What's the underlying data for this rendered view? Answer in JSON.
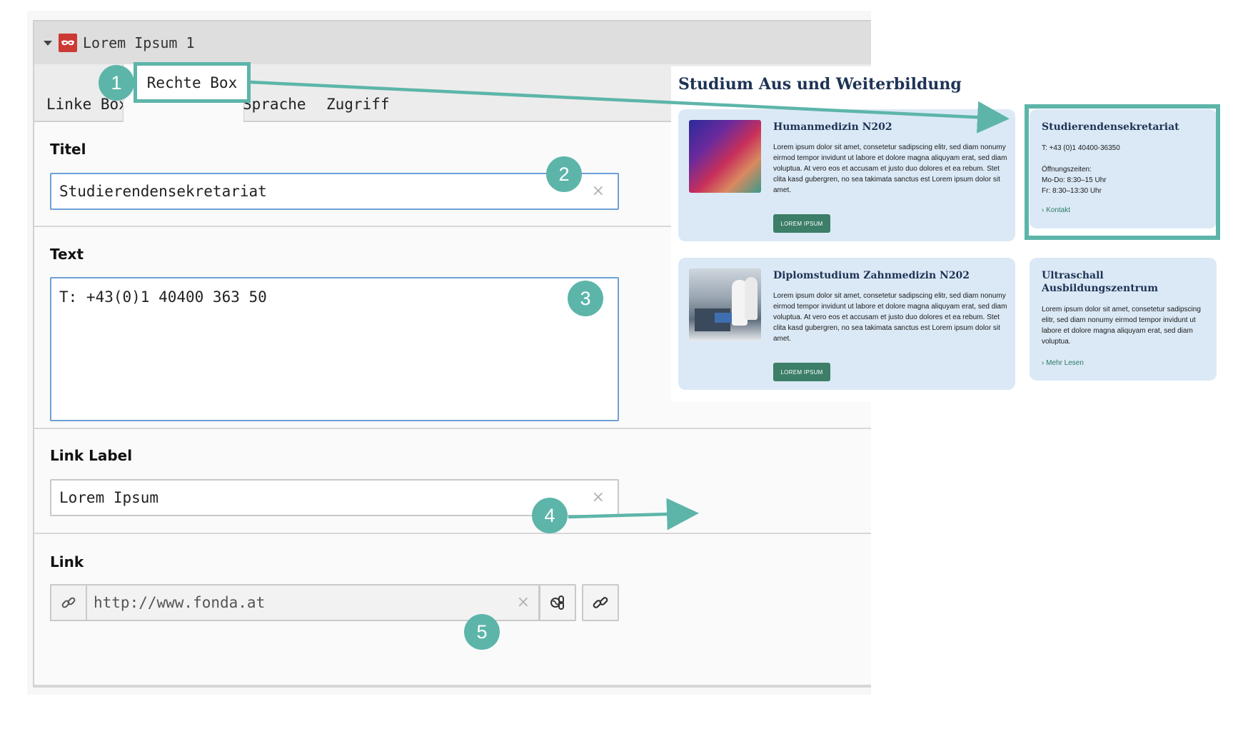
{
  "panel": {
    "title": "Lorem Ipsum 1",
    "content_icon": "mask-icon"
  },
  "tabs": [
    {
      "label": "Linke Box",
      "active": false
    },
    {
      "label": "Rechte Box",
      "active": true
    },
    {
      "label": "Sprache",
      "active": false
    },
    {
      "label": "Zugriff",
      "active": false
    }
  ],
  "fields": {
    "titel": {
      "label": "Titel",
      "value": "Studierendensekretariat",
      "clear_icon": "×"
    },
    "text": {
      "label": "Text",
      "value": "T: +43(0)1 40400 363 50"
    },
    "link_label": {
      "label": "Link Label",
      "value": "Lorem Ipsum",
      "clear_icon": "×"
    },
    "link": {
      "label": "Link",
      "value": "http://www.fonda.at",
      "clear_icon": "×"
    }
  },
  "preview": {
    "heading": "Studium Aus und Weiterbildung",
    "cards": [
      {
        "title": "Humanmedizin N202",
        "body": "Lorem ipsum dolor sit amet, consetetur sadipscing elitr, sed diam nonumy eirmod tempor invidunt ut labore et dolore magna aliquyam erat, sed diam voluptua. At vero eos et accusam et justo duo dolores et ea rebum. Stet clita kasd gubergren, no sea takimata sanctus est Lorem ipsum dolor sit amet.",
        "button": "LOREM IPSUM"
      },
      {
        "title": "Diplomstudium Zahnmedizin N202",
        "body": "Lorem ipsum dolor sit amet, consetetur sadipscing elitr, sed diam nonumy eirmod tempor invidunt ut labore et dolore magna aliquyam erat, sed diam voluptua. At vero eos et accusam et justo duo dolores et ea rebum. Stet clita kasd gubergren, no sea takimata sanctus est Lorem ipsum dolor sit amet.",
        "button": "LOREM IPSUM"
      }
    ],
    "side_boxes": [
      {
        "title": "Studierendensekretariat",
        "phone": "T: +43 (0)1 40400-36350",
        "hours_label": "Öffnungszeiten:",
        "hours_1": "Mo-Do: 8:30–15 Uhr",
        "hours_2": "Fr: 8:30–13:30 Uhr",
        "link": "Kontakt"
      },
      {
        "title": "Ultraschall Ausbildungszentrum",
        "body": "Lorem ipsum dolor sit amet, consetetur sadipscing elitr, sed diam nonumy eirmod tempor invidunt ut labore et dolore magna aliquyam erat, sed diam voluptua.",
        "link": "Mehr Lesen"
      }
    ]
  },
  "annotations": {
    "badges": [
      "1",
      "2",
      "3",
      "4",
      "5"
    ],
    "color": "#5db5aa"
  },
  "colors": {
    "accent": "#5db5aa",
    "button_green": "#3c7e67",
    "card_bg": "#dbe9f6",
    "heading_navy": "#1e3355",
    "content_icon_red": "#cc3b33",
    "focus_border": "#6d9fd6"
  }
}
